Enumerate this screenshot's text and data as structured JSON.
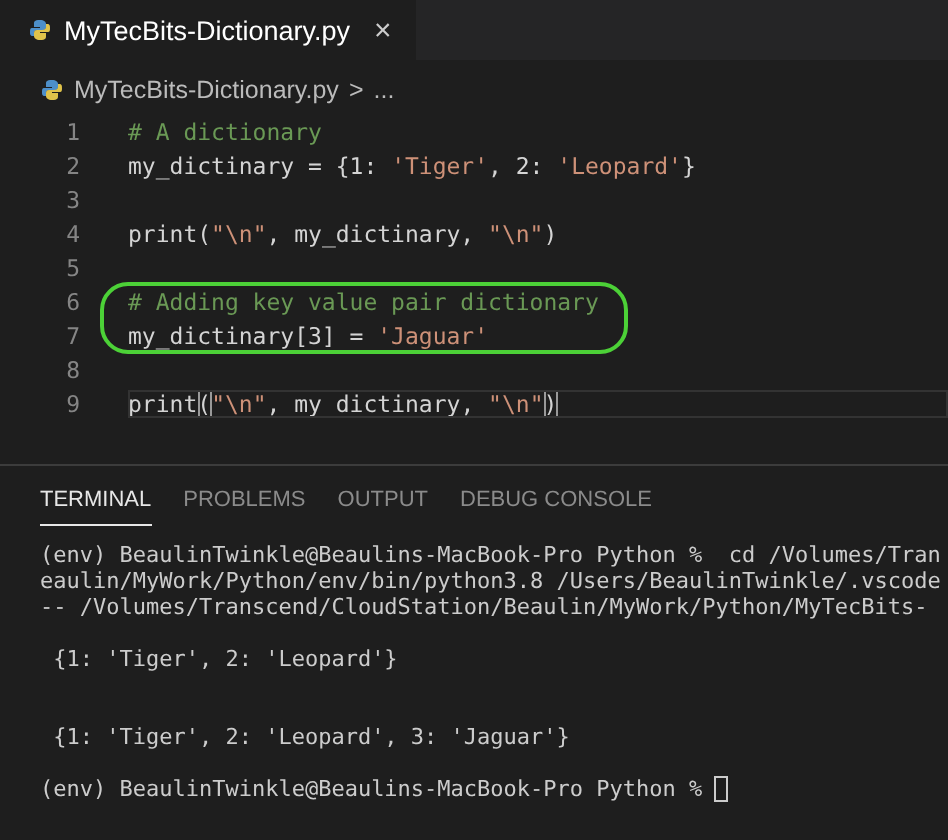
{
  "editor_tabs": [
    {
      "label": "MyTecBits-Dictionary.py",
      "close": "×",
      "selected": true
    }
  ],
  "breadcrumb": {
    "file": "MyTecBits-Dictionary.py",
    "separator": ">",
    "more": "..."
  },
  "code_lines": [
    {
      "number": "1",
      "circled": false,
      "current": false,
      "tokens": [
        {
          "kind": "comment",
          "text": "# A dictionary"
        }
      ]
    },
    {
      "number": "2",
      "circled": false,
      "current": false,
      "tokens": [
        {
          "kind": "plain",
          "text": "my_dictinary = {1: "
        },
        {
          "kind": "string",
          "text": "'Tiger'"
        },
        {
          "kind": "plain",
          "text": ", 2: "
        },
        {
          "kind": "string",
          "text": "'Leopard'"
        },
        {
          "kind": "plain",
          "text": "}"
        }
      ]
    },
    {
      "number": "3",
      "circled": false,
      "current": false
    },
    {
      "number": "4",
      "circled": false,
      "current": false,
      "tokens": [
        {
          "kind": "plain",
          "text": "print("
        },
        {
          "kind": "string",
          "text": "\"\\n\""
        },
        {
          "kind": "plain",
          "text": ", my_dictinary, "
        },
        {
          "kind": "string",
          "text": "\"\\n\""
        },
        {
          "kind": "plain",
          "text": ")"
        }
      ]
    },
    {
      "number": "5",
      "circled": false,
      "current": false
    },
    {
      "number": "6",
      "circled": true,
      "current": false,
      "tokens": [
        {
          "kind": "comment",
          "text": "# Adding key value pair dictionary"
        }
      ]
    },
    {
      "number": "7",
      "circled": true,
      "current": false,
      "tokens": [
        {
          "kind": "plain",
          "text": "my_dictinary[3] = "
        },
        {
          "kind": "string",
          "text": "'Jaguar'"
        }
      ]
    },
    {
      "number": "8",
      "circled": false,
      "current": false
    },
    {
      "number": "9",
      "circled": false,
      "current": true,
      "tokens": [
        {
          "kind": "plain",
          "text": "print"
        },
        {
          "kind": "bracket",
          "text": "("
        },
        {
          "kind": "string",
          "text": "\"\\n\""
        },
        {
          "kind": "plain",
          "text": ", my_dictinary, "
        },
        {
          "kind": "string",
          "text": "\"\\n\""
        },
        {
          "kind": "bracket",
          "text": ")"
        }
      ]
    }
  ],
  "panel_tabs": [
    {
      "label": "TERMINAL",
      "selected": true
    },
    {
      "label": "PROBLEMS",
      "selected": false
    },
    {
      "label": "OUTPUT",
      "selected": false
    },
    {
      "label": "DEBUG CONSOLE",
      "selected": false
    }
  ],
  "terminal_lines": [
    {
      "kind": "text",
      "text": "(env) BeaulinTwinkle@Beaulins-MacBook-Pro Python %  cd /Volumes/Tran"
    },
    {
      "kind": "text",
      "text": "eaulin/MyWork/Python/env/bin/python3.8 /Users/BeaulinTwinkle/.vscode"
    },
    {
      "kind": "text",
      "text": "-- /Volumes/Transcend/CloudStation/Beaulin/MyWork/Python/MyTecBits-"
    },
    {
      "kind": "blank"
    },
    {
      "kind": "text",
      "text": " {1: 'Tiger', 2: 'Leopard'}"
    },
    {
      "kind": "blank"
    },
    {
      "kind": "blank"
    },
    {
      "kind": "text",
      "text": " {1: 'Tiger', 2: 'Leopard', 3: 'Jaguar'}"
    },
    {
      "kind": "blank"
    },
    {
      "kind": "prompt",
      "text": "(env) BeaulinTwinkle@Beaulins-MacBook-Pro Python %"
    }
  ]
}
